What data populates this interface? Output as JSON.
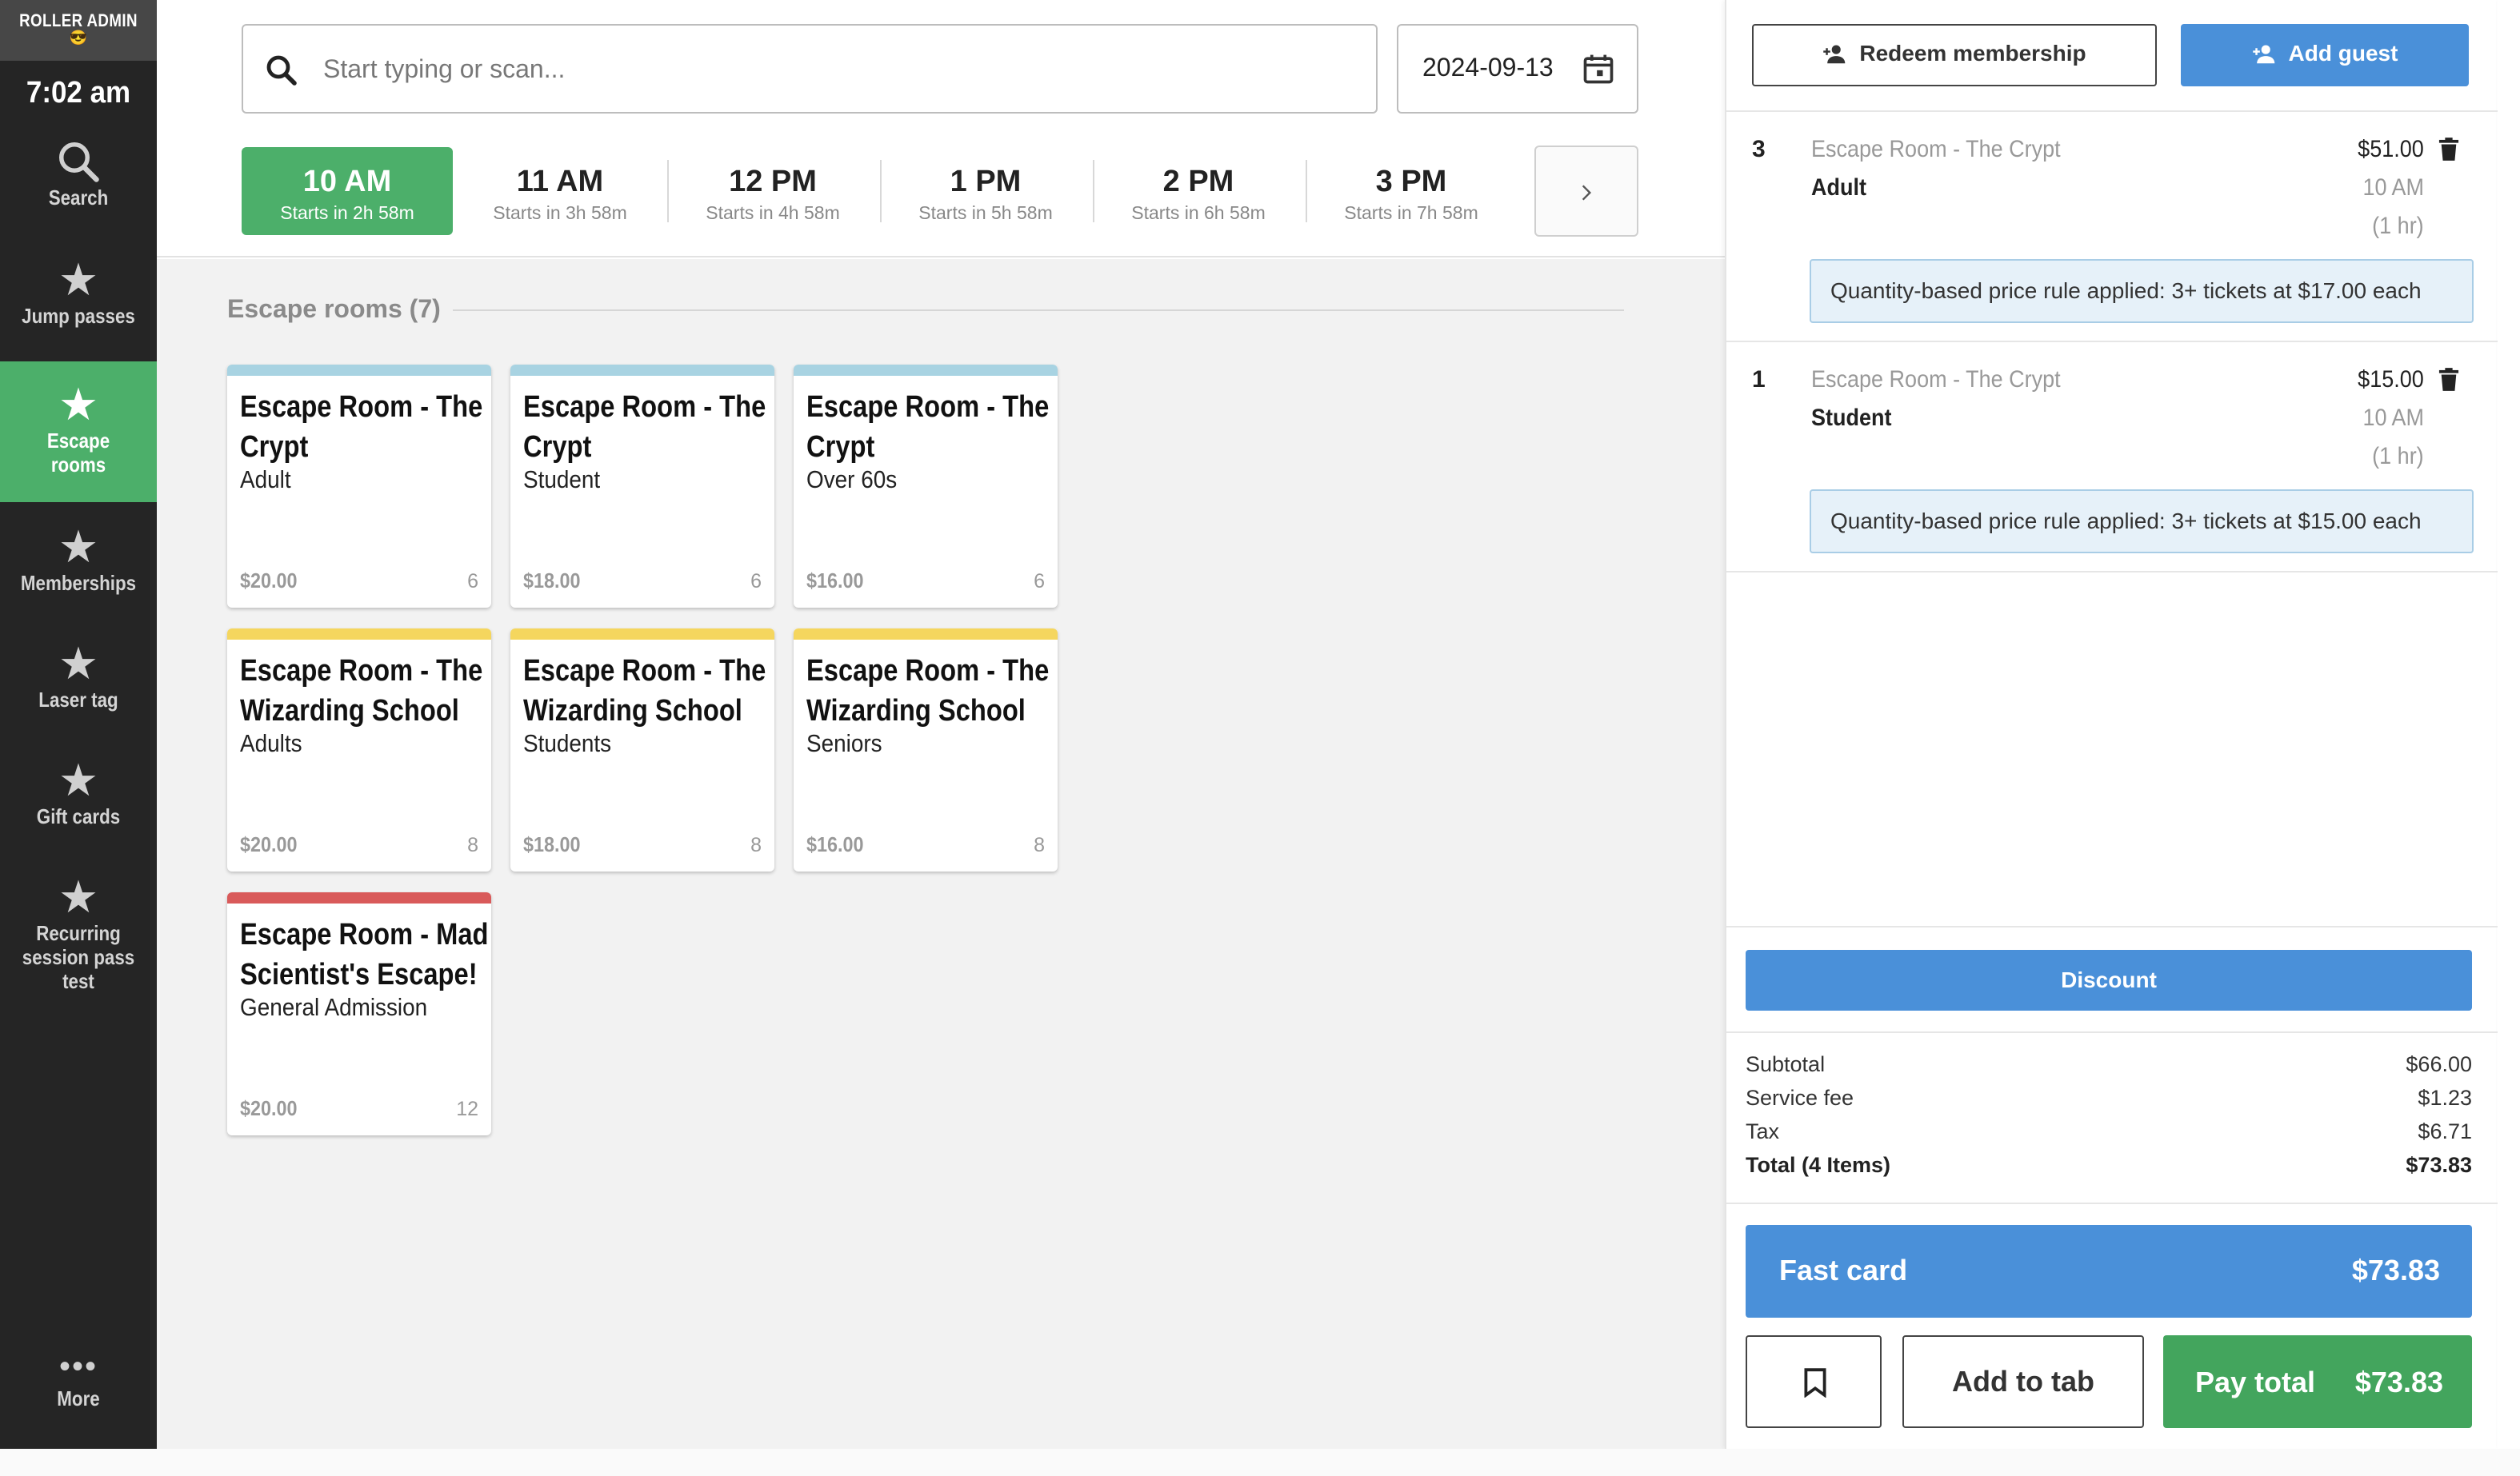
{
  "app": {
    "brand": "ROLLER ADMIN",
    "brand_emoji": "😎",
    "clock": "7:02 am"
  },
  "sidebar": {
    "items": [
      {
        "label": "Search",
        "icon": "search-icon"
      },
      {
        "label": "Jump passes",
        "icon": "star-icon"
      },
      {
        "label": "Escape rooms",
        "icon": "star-icon",
        "active": true
      },
      {
        "label": "Memberships",
        "icon": "star-icon"
      },
      {
        "label": "Laser tag",
        "icon": "star-icon"
      },
      {
        "label": "Gift cards",
        "icon": "star-icon"
      },
      {
        "label": "Recurring session pass test",
        "icon": "star-icon"
      }
    ],
    "more_label": "More"
  },
  "search": {
    "placeholder": "Start typing or scan...",
    "value": ""
  },
  "date": {
    "value": "2024-09-13"
  },
  "sessions": [
    {
      "time": "10 AM",
      "starts": "Starts in 2h 58m",
      "active": true
    },
    {
      "time": "11 AM",
      "starts": "Starts in 3h 58m"
    },
    {
      "time": "12 PM",
      "starts": "Starts in 4h 58m"
    },
    {
      "time": "1 PM",
      "starts": "Starts in 5h 58m"
    },
    {
      "time": "2 PM",
      "starts": "Starts in 6h 58m"
    },
    {
      "time": "3 PM",
      "starts": "Starts in 7h 58m"
    }
  ],
  "section": {
    "title": "Escape rooms (7)"
  },
  "products": [
    {
      "name_line1": "Escape Room - The",
      "name_line2": "Crypt",
      "variant": "Adult",
      "price": "$20.00",
      "count": "6",
      "color": "#a8d3e2"
    },
    {
      "name_line1": "Escape Room - The",
      "name_line2": "Crypt",
      "variant": "Student",
      "price": "$18.00",
      "count": "6",
      "color": "#a8d3e2"
    },
    {
      "name_line1": "Escape Room - The",
      "name_line2": "Crypt",
      "variant": "Over 60s",
      "price": "$16.00",
      "count": "6",
      "color": "#a8d3e2"
    },
    {
      "name_line1": "Escape Room - The",
      "name_line2": "Wizarding School",
      "variant": "Adults",
      "price": "$20.00",
      "count": "8",
      "color": "#f5d65e"
    },
    {
      "name_line1": "Escape Room - The",
      "name_line2": "Wizarding School",
      "variant": "Students",
      "price": "$18.00",
      "count": "8",
      "color": "#f5d65e"
    },
    {
      "name_line1": "Escape Room - The",
      "name_line2": "Wizarding School",
      "variant": "Seniors",
      "price": "$16.00",
      "count": "8",
      "color": "#f5d65e"
    },
    {
      "name_line1": "Escape Room - Mad",
      "name_line2": "Scientist's Escape!",
      "variant": "General Admission",
      "price": "$20.00",
      "count": "12",
      "color": "#d95a5a"
    }
  ],
  "cart": {
    "redeem_label": "Redeem membership",
    "add_guest_label": "Add guest",
    "lines": [
      {
        "qty": "3",
        "product": "Escape Room - The Crypt",
        "variant": "Adult",
        "price": "$51.00",
        "time": "10 AM",
        "duration": "(1 hr)",
        "rule": "Quantity-based price rule applied: 3+ tickets at $17.00 each"
      },
      {
        "qty": "1",
        "product": "Escape Room - The Crypt",
        "variant": "Student",
        "price": "$15.00",
        "time": "10 AM",
        "duration": "(1 hr)",
        "rule": "Quantity-based price rule applied: 3+ tickets at $15.00 each"
      }
    ],
    "discount_label": "Discount",
    "totals": {
      "subtotal_label": "Subtotal",
      "subtotal": "$66.00",
      "service_fee_label": "Service fee",
      "service_fee": "$1.23",
      "tax_label": "Tax",
      "tax": "$6.71",
      "total_label": "Total (4 Items)",
      "total": "$73.83"
    },
    "fast_card_label": "Fast card",
    "fast_card_amount": "$73.83",
    "add_to_tab_label": "Add to tab",
    "pay_total_label": "Pay total",
    "pay_total_amount": "$73.83"
  },
  "colors": {
    "sidebar_bg": "#252525",
    "active_green": "#4caf6a",
    "primary_blue": "#4a90d9",
    "pay_green": "#43a55d"
  }
}
